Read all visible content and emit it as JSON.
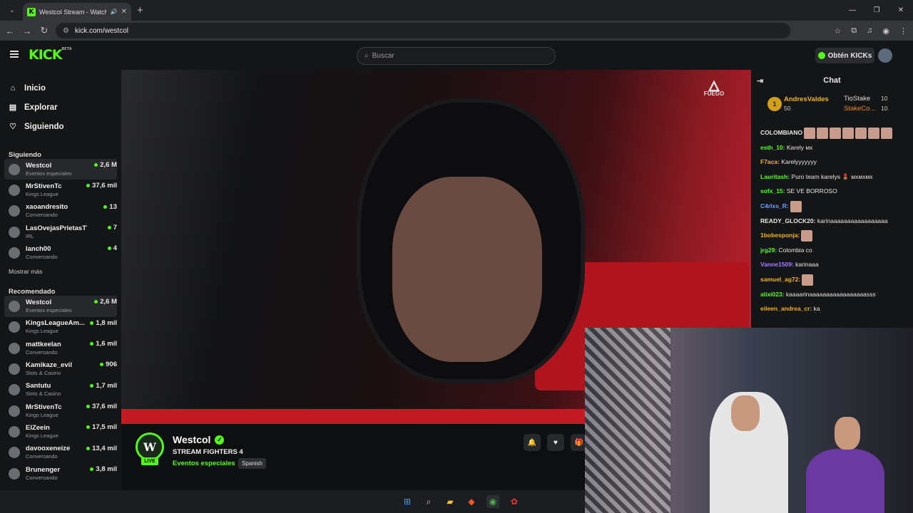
{
  "browser": {
    "tab_title": "Westcol Stream - Watch Li...",
    "favicon": "K",
    "url": "kick.com/westcol"
  },
  "kick": {
    "logo": "KICK",
    "logo_tag": "BETA",
    "search_placeholder": "Buscar",
    "get_kicks": "Obtén KICKs"
  },
  "sidebar": {
    "nav": [
      {
        "label": "Inicio"
      },
      {
        "label": "Explorar"
      },
      {
        "label": "Siguiendo"
      }
    ],
    "following_title": "Siguiendo",
    "following": [
      {
        "name": "Westcol",
        "category": "Eventos especiales",
        "viewers": "2,6 M"
      },
      {
        "name": "MrStivenTc",
        "category": "Kings League",
        "viewers": "37,6 mil"
      },
      {
        "name": "xaoandresito",
        "category": "Conversando",
        "viewers": "13"
      },
      {
        "name": "LasOvejasPrietasTV",
        "category": "IRL",
        "viewers": "7"
      },
      {
        "name": "lanch00",
        "category": "Conversando",
        "viewers": "4"
      }
    ],
    "show_more": "Mostrar más",
    "recommended_title": "Recomendado",
    "recommended": [
      {
        "name": "Westcol",
        "category": "Eventos especiales",
        "viewers": "2,6 M"
      },
      {
        "name": "KingsLeagueAm...",
        "category": "Kings League",
        "viewers": "1,8 mil"
      },
      {
        "name": "mattkeelan",
        "category": "Conversando",
        "viewers": "1,6 mil"
      },
      {
        "name": "Kamikaze_evil",
        "category": "Slots & Casino",
        "viewers": "906"
      },
      {
        "name": "Santutu",
        "category": "Slots & Casino",
        "viewers": "1,7 mil"
      },
      {
        "name": "MrStivenTc",
        "category": "Kings League",
        "viewers": "37,6 mil"
      },
      {
        "name": "ElZeein",
        "category": "Kings League",
        "viewers": "17,5 mil"
      },
      {
        "name": "davooxeneize",
        "category": "Conversando",
        "viewers": "13,4 mil"
      },
      {
        "name": "Brunenger",
        "category": "Conversando",
        "viewers": "3,8 mil"
      }
    ]
  },
  "video": {
    "watermark_line1": "FUEGO"
  },
  "stream": {
    "avatar_text": "W",
    "live": "LIVE",
    "name": "Westcol",
    "title": "STREAM FIGHTERS 4",
    "category": "Eventos especiales",
    "language": "Spanish"
  },
  "chat": {
    "title": "Chat",
    "pinned": [
      {
        "rank": "1",
        "user": "AndresValdes",
        "value": "50"
      },
      {
        "user": "TioStake",
        "value": "10"
      },
      {
        "user": "StakeCo...",
        "value": "10"
      }
    ],
    "messages": [
      {
        "user": "COLOMBIANO",
        "text": "",
        "color": "#e6e6e6",
        "emotes": 7
      },
      {
        "user": "esth_10:",
        "text": "Karely ᴍx",
        "color": "#53fc18",
        "emotes": 0
      },
      {
        "user": "F7aca:",
        "text": "Karelyyyyyyy",
        "color": "#f2b21f",
        "emotes": 0
      },
      {
        "user": "Lauritash:",
        "text": "Puro team karelys 💄 ᴍxᴍxᴍx",
        "color": "#53fc18",
        "emotes": 0
      },
      {
        "user": "sofx_15:",
        "text": "SE VE BORROSO",
        "color": "#53fc18",
        "emotes": 0
      },
      {
        "user": "C4rlxs_R:",
        "text": "",
        "color": "#6aa0ff",
        "emotes": 1
      },
      {
        "user": "READY_GLOCK20:",
        "text": "karinaaaaaaaaaaaaaaaaa",
        "color": "#e6e6e6",
        "emotes": 0
      },
      {
        "user": "1bobesponja:",
        "text": "",
        "color": "#f2b21f",
        "emotes": 1
      },
      {
        "user": "jrg29:",
        "text": "Colombia co",
        "color": "#53fc18",
        "emotes": 0
      },
      {
        "user": "Vanne1509:",
        "text": "karinaaa",
        "color": "#a57bff",
        "emotes": 0
      },
      {
        "user": "samuel_ag72:",
        "text": "",
        "color": "#f2b21f",
        "emotes": 1
      },
      {
        "user": "alixi023:",
        "text": "kaaaarinaaaaaaaaaaaaaaaaasss",
        "color": "#53fc18",
        "emotes": 0
      },
      {
        "user": "eileen_andrea_cr:",
        "text": "ka",
        "color": "#f2b21f",
        "emotes": 0
      }
    ]
  }
}
